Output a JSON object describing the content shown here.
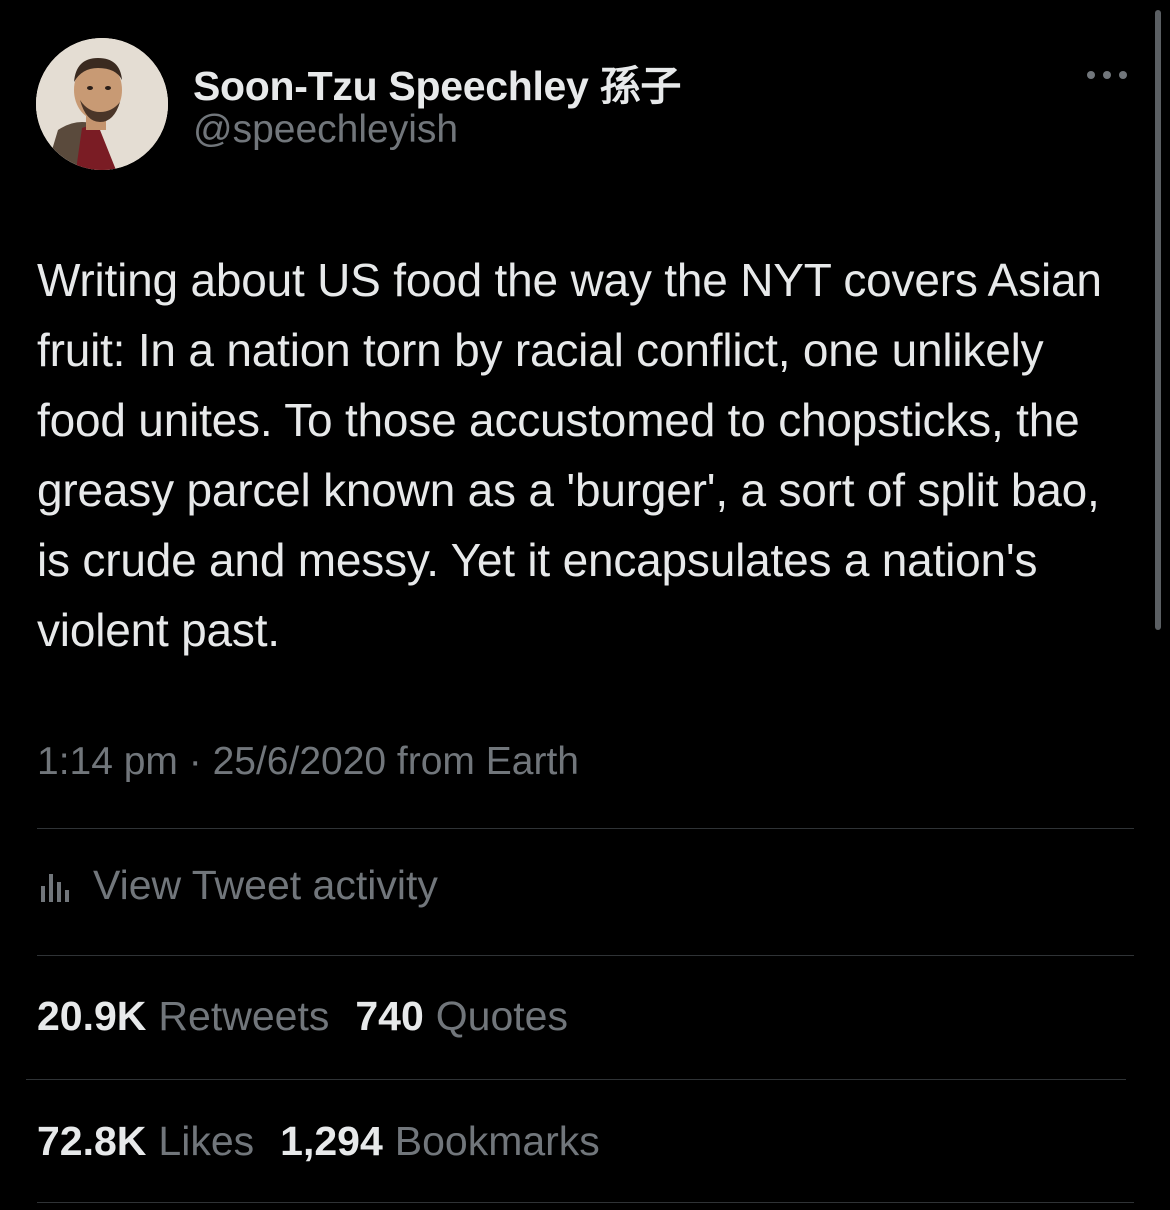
{
  "author": {
    "display_name": "Soon-Tzu Speechley 孫子",
    "handle": "@speechleyish"
  },
  "more_icon": "more-horizontal-icon",
  "tweet": {
    "text": "Writing about US food the way the NYT covers Asian fruit: In a nation torn by racial conflict, one unlikely food unites. To those accustomed to chopsticks, the greasy parcel known as a 'burger', a sort of split bao, is crude and messy. Yet it encapsulates a nation's violent past.",
    "timestamp": "1:14 pm · 25/6/2020 from Earth"
  },
  "activity": {
    "icon": "bar-chart-icon",
    "label": "View Tweet activity"
  },
  "stats": {
    "retweets_count": "20.9K",
    "retweets_label": "Retweets",
    "quotes_count": "740",
    "quotes_label": "Quotes",
    "likes_count": "72.8K",
    "likes_label": "Likes",
    "bookmarks_count": "1,294",
    "bookmarks_label": "Bookmarks"
  },
  "colors": {
    "background": "#000000",
    "primary_text": "#e7e9ea",
    "secondary_text": "#71767b",
    "divider": "#2f3336"
  }
}
